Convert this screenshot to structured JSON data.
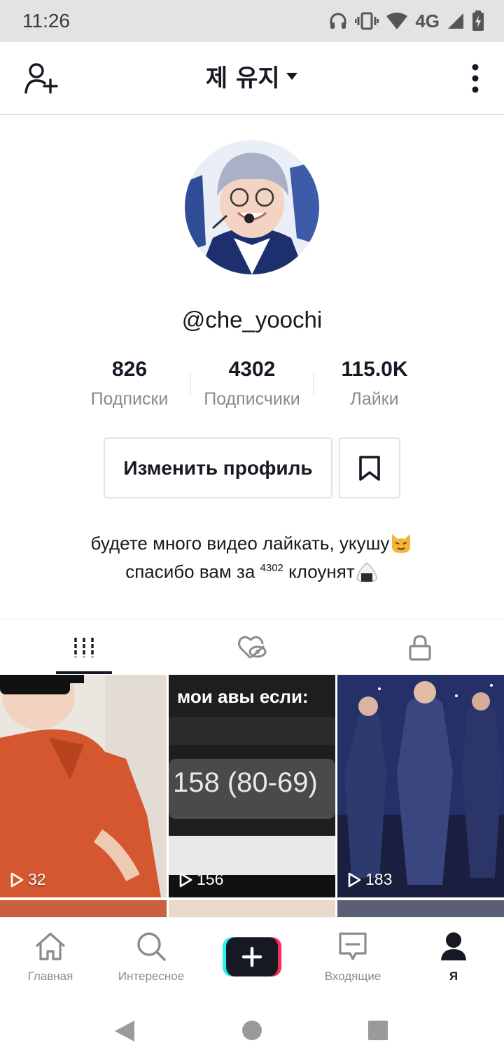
{
  "status_bar": {
    "time": "11:26",
    "network": "4G",
    "icons": [
      "headphones-icon",
      "vibrate-icon",
      "wifi-icon",
      "signal-icon",
      "battery-charging-icon"
    ]
  },
  "header": {
    "title": "제 유지",
    "left_icon": "add-user-icon",
    "right_icon": "more-vertical-icon"
  },
  "profile": {
    "username": "@che_yoochi",
    "stats": [
      {
        "value": "826",
        "label": "Подписки"
      },
      {
        "value": "4302",
        "label": "Подписчики"
      },
      {
        "value": "115.0K",
        "label": "Лайки"
      }
    ],
    "edit_label": "Изменить профиль",
    "bio_line1": "будете много видео лайкать, укушу",
    "bio_line2_prefix": "спасибо вам за ",
    "bio_sup": "4302",
    "bio_line2_suffix": " клоунят"
  },
  "tabs": [
    {
      "icon": "videos-grid-icon",
      "active": true
    },
    {
      "icon": "liked-hidden-icon",
      "active": false
    },
    {
      "icon": "lock-icon",
      "active": false
    }
  ],
  "videos": [
    {
      "views": "32"
    },
    {
      "views": "156",
      "overlay_title": "мои авы если:",
      "overlay_value": "158 (80-69)"
    },
    {
      "views": "183"
    }
  ],
  "bottom_nav": [
    {
      "label": "Главная",
      "icon": "home-icon"
    },
    {
      "label": "Интересное",
      "icon": "search-icon"
    },
    {
      "label": "",
      "icon": "create-plus-icon"
    },
    {
      "label": "Входящие",
      "icon": "inbox-icon"
    },
    {
      "label": "Я",
      "icon": "profile-icon",
      "active": true
    }
  ],
  "colors": {
    "text_primary": "#161823",
    "text_secondary": "#8a8b91",
    "border": "#e3e3e4",
    "create_cyan": "#25f4ee",
    "create_red": "#fe2c55"
  }
}
